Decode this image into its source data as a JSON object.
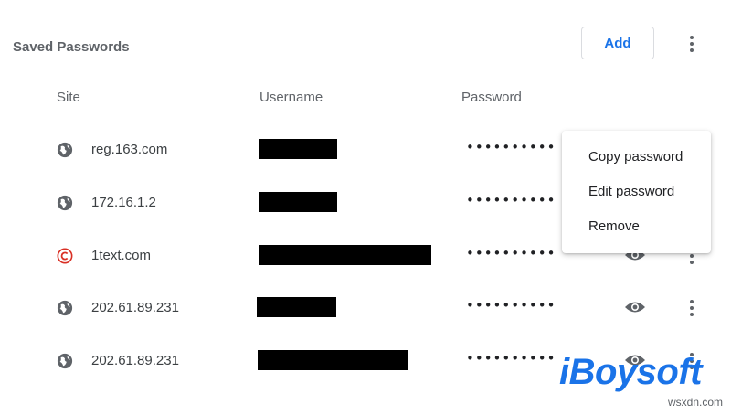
{
  "header": {
    "title": "Saved Passwords",
    "add_label": "Add"
  },
  "columns": {
    "site": "Site",
    "username": "Username",
    "password": "Password"
  },
  "rows": [
    {
      "site": "reg.163.com",
      "icon": "globe-icon",
      "password_mask": "••••••••••"
    },
    {
      "site": "172.16.1.2",
      "icon": "globe-icon",
      "password_mask": "••••••••••"
    },
    {
      "site": "1text.com",
      "icon": "copyright-favicon-icon",
      "password_mask": "••••••••••"
    },
    {
      "site": "202.61.89.231",
      "icon": "globe-icon",
      "password_mask": "••••••••••"
    },
    {
      "site": "202.61.89.231",
      "icon": "globe-icon",
      "password_mask": "••••••••••"
    }
  ],
  "context_menu": {
    "items": [
      "Copy password",
      "Edit password",
      "Remove"
    ]
  },
  "watermark": {
    "brand": "iBoysoft",
    "site": "wsxdn.com"
  },
  "colors": {
    "accent": "#1a73e8",
    "redaction": "#000000",
    "favicon_red": "#d93025"
  }
}
